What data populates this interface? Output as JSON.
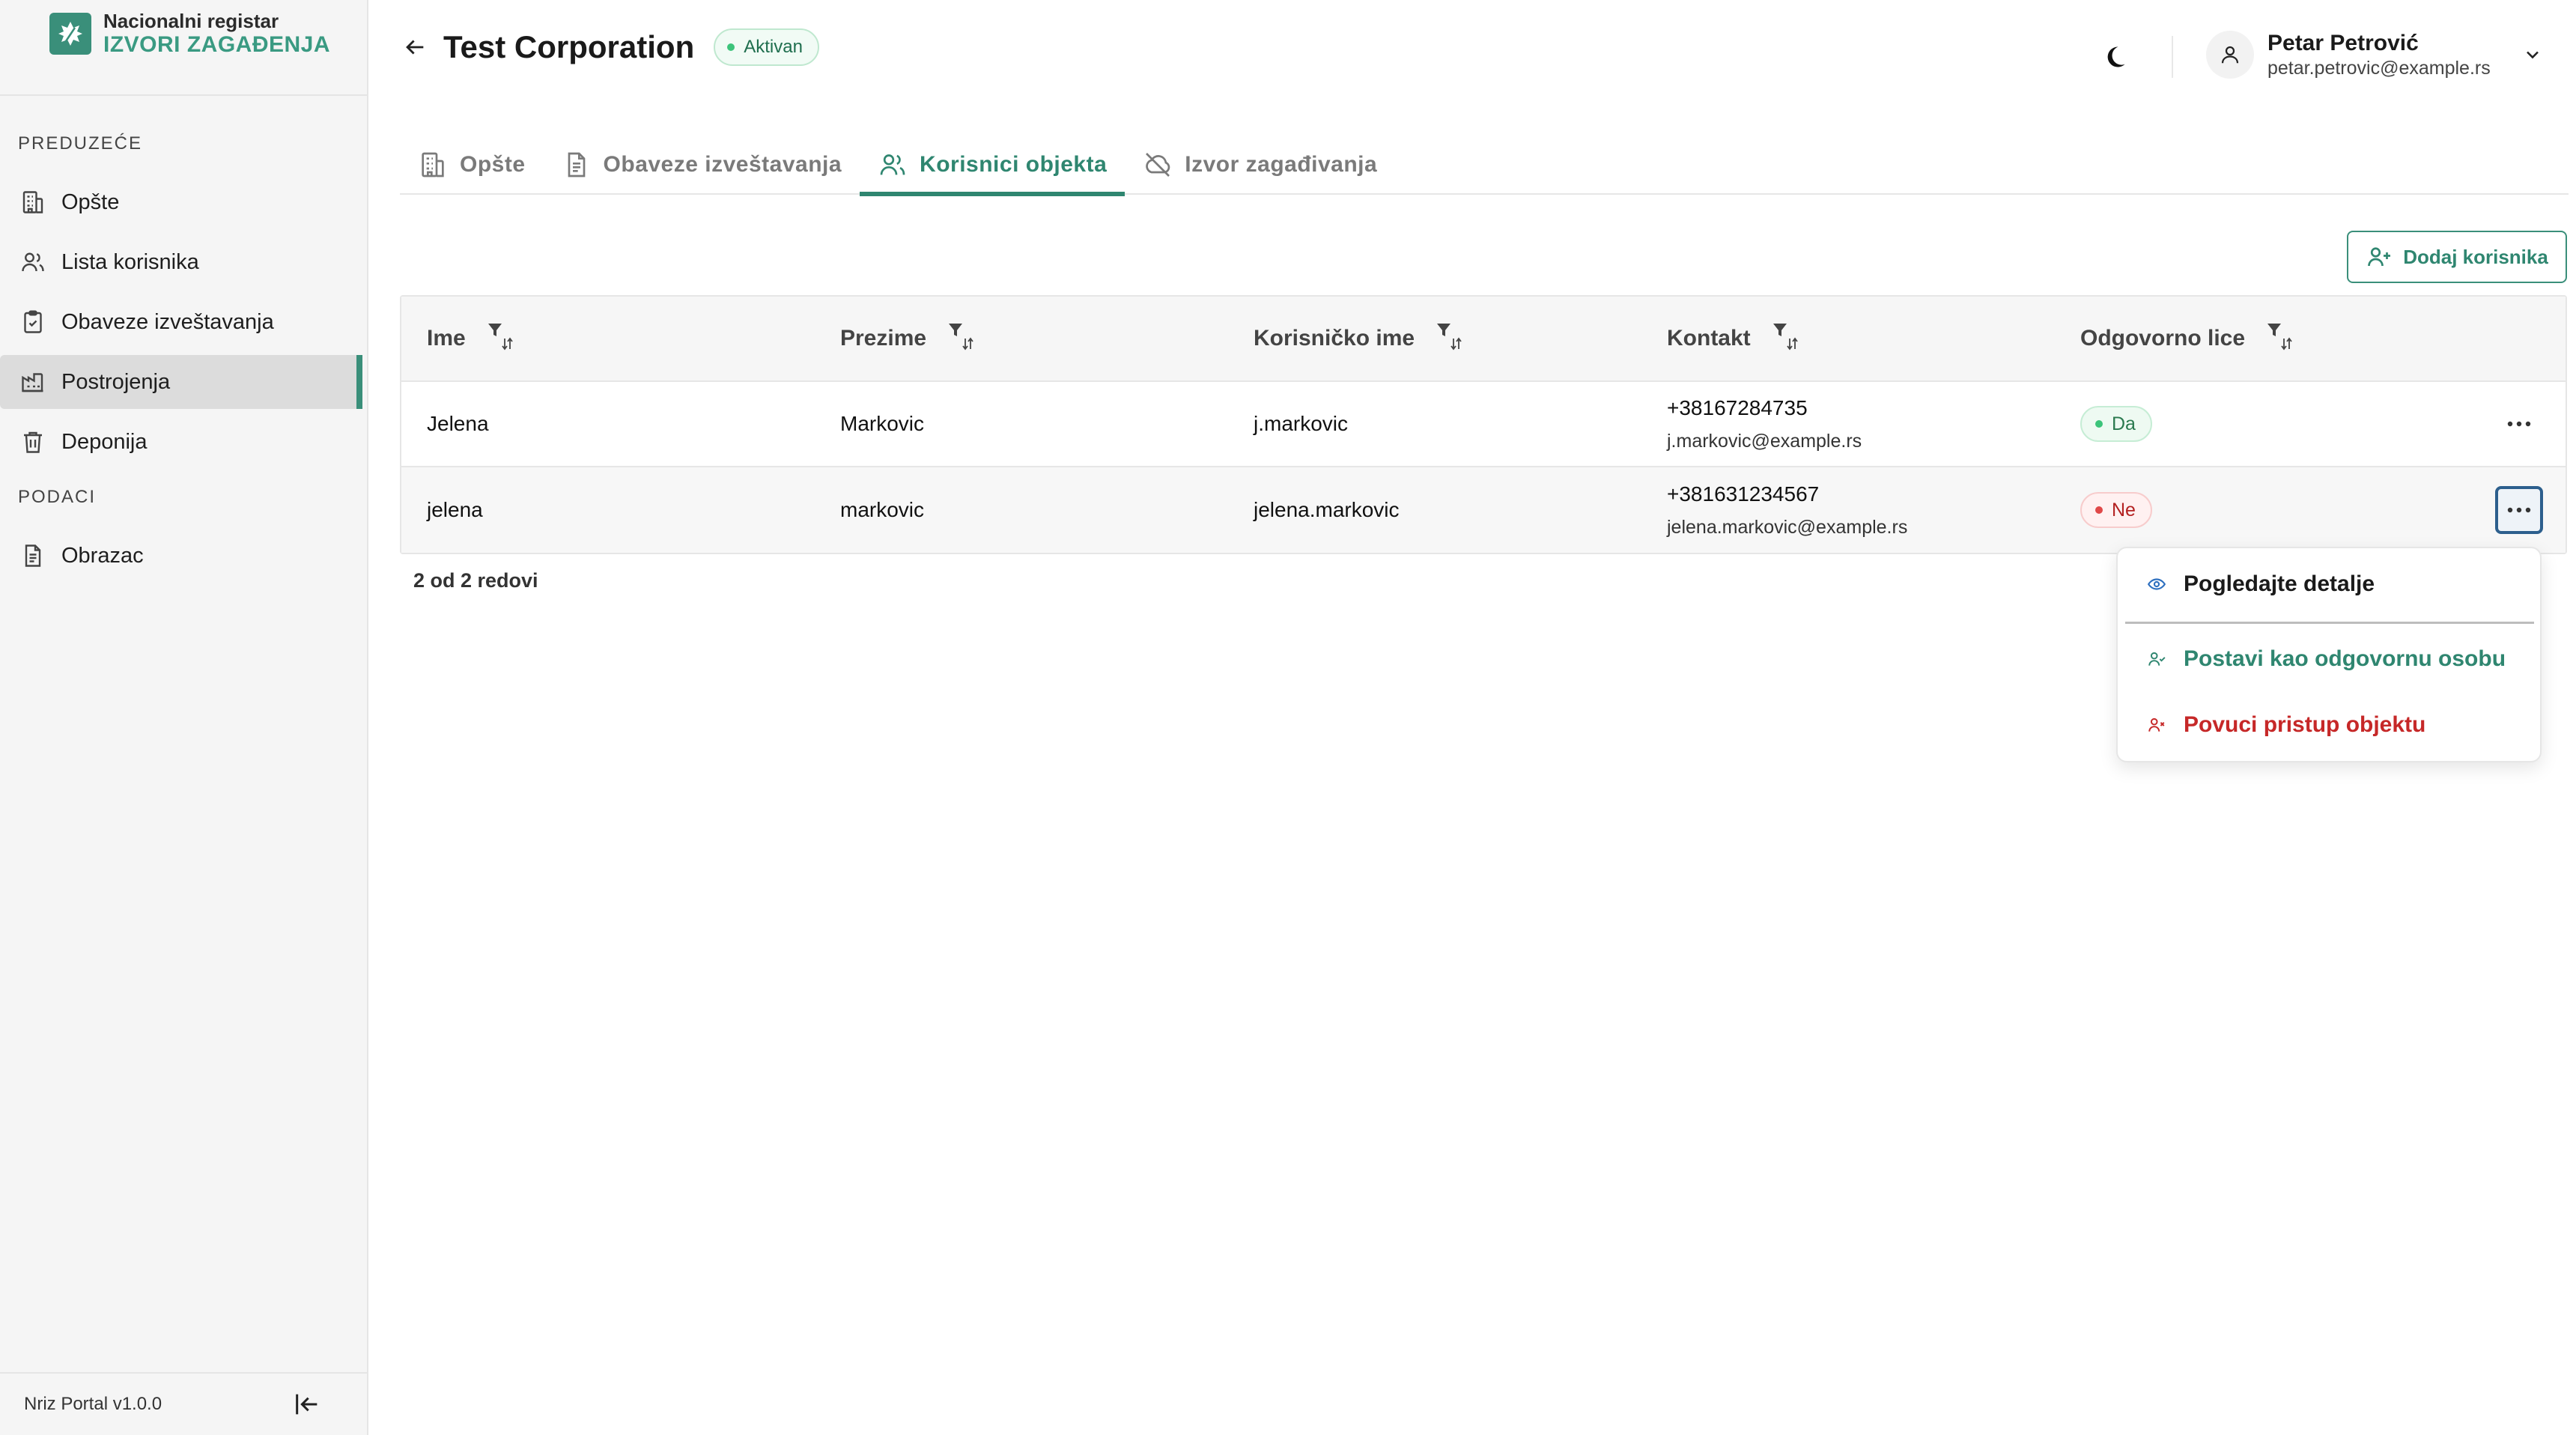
{
  "sidebar": {
    "logo_line1": "Nacionalni registar",
    "logo_line2": "IZVORI ZAGAĐENJA",
    "section_company": "PREDUZEĆE",
    "section_data": "PODACI",
    "items": [
      {
        "label": "Opšte",
        "icon": "building-icon"
      },
      {
        "label": "Lista korisnika",
        "icon": "users-icon"
      },
      {
        "label": "Obaveze izveštavanja",
        "icon": "clipboard-check-icon"
      },
      {
        "label": "Postrojenja",
        "icon": "factory-icon",
        "active": true
      },
      {
        "label": "Deponija",
        "icon": "trash-icon"
      },
      {
        "label": "Obrazac",
        "icon": "document-icon"
      }
    ],
    "version": "Nriz Portal v1.0.0"
  },
  "header": {
    "title": "Test Corporation",
    "status": "Aktivan",
    "user_name": "Petar Petrović",
    "user_email": "petar.petrovic@example.rs"
  },
  "tabs": [
    {
      "label": "Opšte",
      "icon": "building-icon"
    },
    {
      "label": "Obaveze izveštavanja",
      "icon": "document-icon"
    },
    {
      "label": "Korisnici objekta",
      "icon": "users-icon",
      "active": true
    },
    {
      "label": "Izvor zagađivanja",
      "icon": "cloud-off-icon"
    }
  ],
  "actions": {
    "add_user": "Dodaj korisnika"
  },
  "table": {
    "columns": [
      "Ime",
      "Prezime",
      "Korisničko ime",
      "Kontakt",
      "Odgovorno lice"
    ],
    "rows": [
      {
        "ime": "Jelena",
        "prezime": "Markovic",
        "username": "j.markovic",
        "phone": "+38167284735",
        "email": "j.markovic@example.rs",
        "responsible": "Da"
      },
      {
        "ime": "jelena",
        "prezime": "markovic",
        "username": "jelena.markovic",
        "phone": "+381631234567",
        "email": "jelena.markovic@example.rs",
        "responsible": "Ne"
      }
    ],
    "row_count": "2 od 2 redovi"
  },
  "menu": {
    "view_details": "Pogledajte detalje",
    "set_responsible": "Postavi kao odgovornu osobu",
    "revoke_access": "Povuci pristup objektu"
  },
  "colors": {
    "accent": "#2f8670",
    "danger": "#c62828",
    "success": "#3cc47a"
  }
}
